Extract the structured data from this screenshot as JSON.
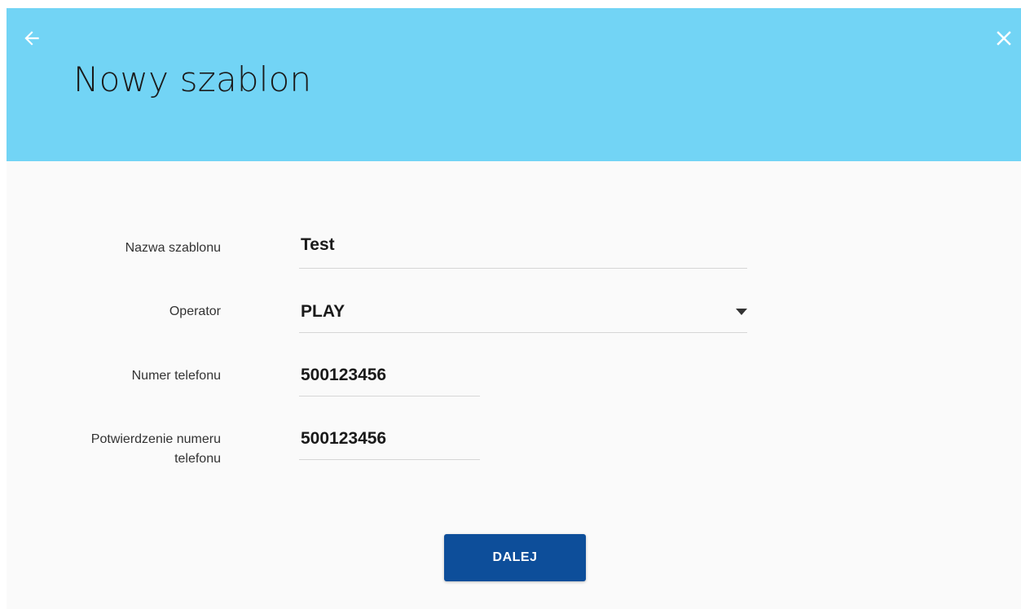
{
  "header": {
    "title": "Nowy szablon",
    "back_icon": "arrow-left-icon",
    "close_icon": "close-icon",
    "background": "#72d4f5"
  },
  "form": {
    "template_name": {
      "label": "Nazwa szablonu",
      "value": "Test"
    },
    "operator": {
      "label": "Operator",
      "value": "PLAY",
      "icon": "caret-down-icon"
    },
    "phone_number": {
      "label": "Numer telefonu",
      "value": "500123456"
    },
    "phone_confirm": {
      "label_line1": "Potwierdzenie numeru",
      "label_line2": "telefonu",
      "value": "500123456"
    }
  },
  "actions": {
    "next_label": "DALEJ",
    "next_color": "#0d4e9a"
  }
}
